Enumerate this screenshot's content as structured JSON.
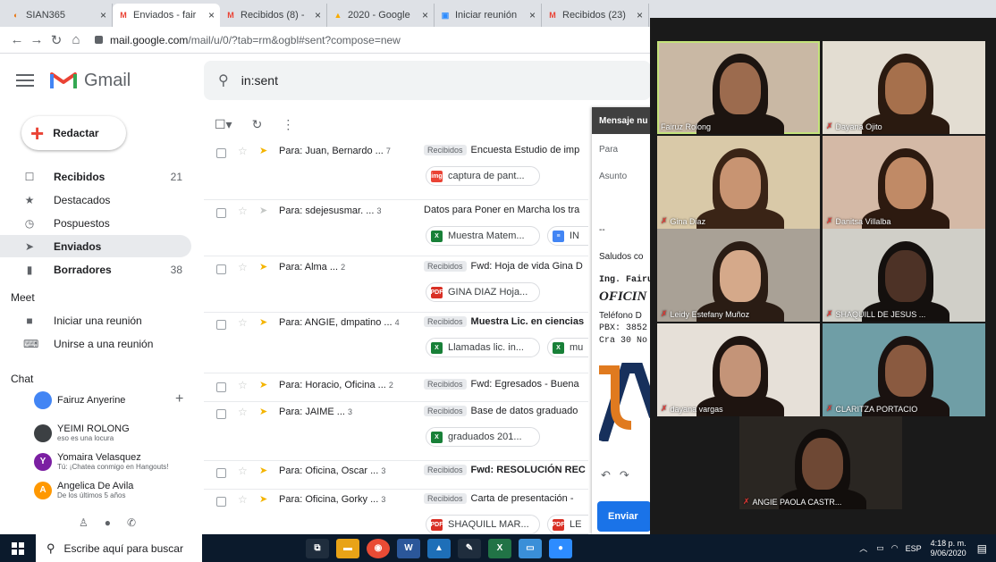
{
  "browser": {
    "tabs": [
      {
        "label": "SIAN365",
        "icon": "sian-icon",
        "active": false
      },
      {
        "label": "Enviados - fair",
        "icon": "gmail-icon",
        "active": true
      },
      {
        "label": "Recibidos (8) -",
        "icon": "gmail-icon",
        "active": false
      },
      {
        "label": "2020 - Google",
        "icon": "drive-icon",
        "active": false
      },
      {
        "label": "Iniciar reunión",
        "icon": "zoom-icon",
        "active": false
      },
      {
        "label": "Recibidos (23)",
        "icon": "gmail-icon",
        "active": false
      }
    ],
    "url_host": "mail.google.com",
    "url_path": "/mail/u/0/?tab=rm&ogbl#sent?compose=new"
  },
  "gmail": {
    "product": "Gmail",
    "search_query": "in:sent",
    "compose_label": "Redactar",
    "nav": [
      {
        "label": "Recibidos",
        "count": "21",
        "icon": "inbox-icon",
        "bold": true,
        "selected": false
      },
      {
        "label": "Destacados",
        "count": "",
        "icon": "star-icon",
        "bold": false,
        "selected": false
      },
      {
        "label": "Pospuestos",
        "count": "",
        "icon": "clock-icon",
        "bold": false,
        "selected": false
      },
      {
        "label": "Enviados",
        "count": "",
        "icon": "send-icon",
        "bold": true,
        "selected": true
      },
      {
        "label": "Borradores",
        "count": "38",
        "icon": "draft-icon",
        "bold": true,
        "selected": false
      }
    ],
    "meet_title": "Meet",
    "meet_items": [
      {
        "label": "Iniciar una reunión",
        "icon": "video-icon"
      },
      {
        "label": "Unirse a una reunión",
        "icon": "keyboard-icon"
      }
    ],
    "chat_title": "Chat",
    "chat_user": "Fairuz Anyerine",
    "chat_contacts": [
      {
        "name": "YEIMI ROLONG",
        "status": "eso es una locura",
        "initial": "",
        "color": "#3c4043"
      },
      {
        "name": "Yomaira Velasquez",
        "status": "Tú: ¡Chatea conmigo en Hangouts!",
        "initial": "Y",
        "color": "#7b1fa2"
      },
      {
        "name": "Angelica De Avila",
        "status": "De los últimos 5 años",
        "initial": "A",
        "color": "#ff9800"
      }
    ]
  },
  "emails": [
    {
      "to": "Para: Juan, Bernardo",
      "n": "7",
      "label": "Recibidos",
      "subject": "Encuesta Estudio de imp",
      "bold": false,
      "important": true,
      "attachments": [
        {
          "name": "captura de pant...",
          "type": "img",
          "color": "#ea4335"
        }
      ]
    },
    {
      "to": "Para: sdejesusmar.",
      "n": "3",
      "label": "",
      "subject": "Datos para Poner en Marcha los tra",
      "bold": false,
      "important": false,
      "attachments": [
        {
          "name": "Muestra Matem...",
          "type": "X",
          "color": "#188038"
        },
        {
          "name": "IN",
          "type": "≡",
          "color": "#4285f4"
        }
      ]
    },
    {
      "to": "Para: Alma",
      "n": "2",
      "label": "Recibidos",
      "subject": "Fwd: Hoja de vida Gina D",
      "bold": false,
      "important": true,
      "attachments": [
        {
          "name": "GINA DIAZ Hoja...",
          "type": "PDF",
          "color": "#d93025"
        }
      ]
    },
    {
      "to": "Para: ANGIE, dmpatino",
      "n": "4",
      "label": "Recibidos",
      "subject": "Muestra Lic. en ciencias",
      "bold": true,
      "important": true,
      "attachments": [
        {
          "name": "Llamadas lic. in...",
          "type": "X",
          "color": "#188038"
        },
        {
          "name": "mu",
          "type": "X",
          "color": "#188038"
        }
      ]
    },
    {
      "to": "Para: Horacio, Oficina",
      "n": "2",
      "label": "Recibidos",
      "subject": "Fwd: Egresados - Buena",
      "bold": false,
      "important": true,
      "attachments": []
    },
    {
      "to": "Para: JAIME",
      "n": "3",
      "label": "Recibidos",
      "subject": "Base de datos graduado",
      "bold": false,
      "important": true,
      "attachments": [
        {
          "name": "graduados 201...",
          "type": "X",
          "color": "#188038"
        }
      ]
    },
    {
      "to": "Para: Oficina, Oscar",
      "n": "3",
      "label": "Recibidos",
      "subject": "Fwd: RESOLUCIÓN REC",
      "bold": true,
      "important": true,
      "attachments": []
    },
    {
      "to": "Para: Oficina, Gorky",
      "n": "3",
      "label": "Recibidos",
      "subject": "Carta de presentación -",
      "bold": false,
      "important": true,
      "attachments": [
        {
          "name": "SHAQUILL MAR...",
          "type": "PDF",
          "color": "#d93025"
        },
        {
          "name": "LE",
          "type": "PDF",
          "color": "#d93025"
        }
      ]
    }
  ],
  "compose": {
    "title": "Mensaje nu",
    "to_label": "Para",
    "subject_label": "Asunto",
    "dashes": "--",
    "greeting": "Saludos co",
    "sig_name": "Ing. Fairu",
    "sig_office": "OFICIN",
    "sig_phone": "Teléfono D",
    "sig_pbx": "PBX: 3852",
    "sig_addr": "Cra 30 No",
    "send_label": "Enviar"
  },
  "zoom": {
    "participants": [
      {
        "name": "Fairuz Rolong",
        "muted": false,
        "highlight": true,
        "bg": "#c9b8a4",
        "skin": "#9c6b4e",
        "hair": "#1c1410"
      },
      {
        "name": "Dayana Ojito",
        "muted": true,
        "highlight": false,
        "bg": "#e3ddd2",
        "skin": "#a6704c",
        "hair": "#2a1a10"
      },
      {
        "name": "Gina Diaz",
        "muted": true,
        "highlight": false,
        "bg": "#d9c9a8",
        "skin": "#c89472",
        "hair": "#3a2416"
      },
      {
        "name": "Danitsa Villalba",
        "muted": true,
        "highlight": false,
        "bg": "#d4b9a6",
        "skin": "#c08a66",
        "hair": "#2d1a10"
      },
      {
        "name": "Leidy Estefany Muñoz",
        "muted": true,
        "highlight": false,
        "bg": "#a9a196",
        "skin": "#d5a98a",
        "hair": "#2a1c14"
      },
      {
        "name": "SHAQUILL DE JESUS ...",
        "muted": true,
        "highlight": false,
        "bg": "#d0cfc8",
        "skin": "#4d3226",
        "hair": "#14100e"
      },
      {
        "name": "dayana vargas",
        "muted": true,
        "highlight": false,
        "bg": "#e6e0d8",
        "skin": "#c49478",
        "hair": "#1e1410"
      },
      {
        "name": "CLARITZA PORTACIO",
        "muted": true,
        "highlight": false,
        "bg": "#6f9ea6",
        "skin": "#8a5a40",
        "hair": "#1a1210"
      },
      {
        "name": "ANGIE PAOLA CASTR...",
        "muted": true,
        "highlight": false,
        "bg": "#2a2622",
        "skin": "#6e4834",
        "hair": "#120e0c"
      }
    ]
  },
  "taskbar": {
    "search_placeholder": "Escribe aquí para buscar",
    "lang": "ESP",
    "time": "4:18 p. m.",
    "date": "9/06/2020"
  }
}
